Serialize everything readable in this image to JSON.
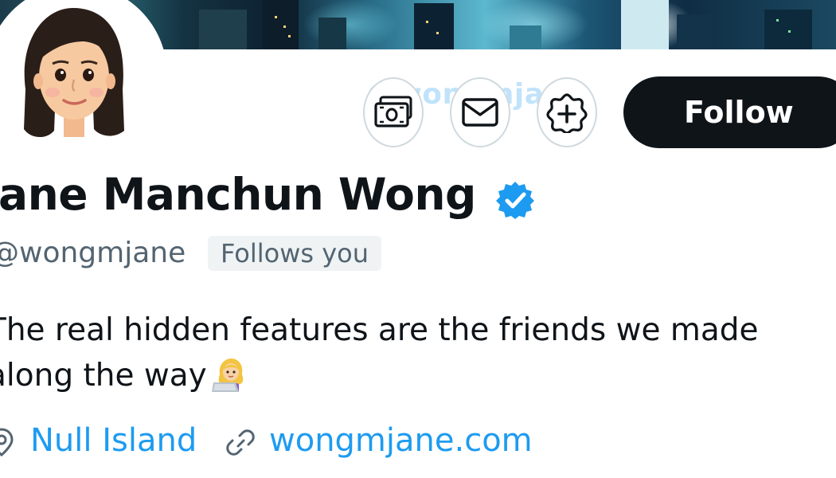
{
  "profile": {
    "display_name": "Jane Manchun Wong",
    "handle": "@wongmjane",
    "follows_you": "Follows you",
    "bio": "The real hidden features are the friends we made along the way",
    "bio_emoji": "woman-technologist-emoji",
    "location": "Null Island",
    "website": "wongmjane.com",
    "verified": true
  },
  "actions": {
    "follow_label": "Follow",
    "tip_icon": "money-icon",
    "message_icon": "mail-icon",
    "subscribe_icon": "add-notification-icon"
  },
  "watermark": "@wongmjane",
  "colors": {
    "accent": "#1d9bf0",
    "follow_bg": "#0f1419",
    "muted": "#536471",
    "badge_bg": "#eff3f4"
  }
}
